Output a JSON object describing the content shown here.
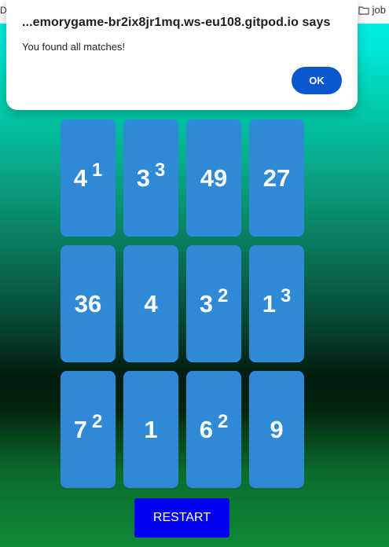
{
  "browser": {
    "left_fragment": "Dr",
    "bookmark_label": "job"
  },
  "dialog": {
    "title": "...emorygame-br2ix8jr1mq.ws-eu108.gitpod.io says",
    "message": "You found all matches!",
    "ok_label": "OK"
  },
  "cards": [
    {
      "base": "4",
      "exp": "1"
    },
    {
      "base": "3",
      "exp": "3"
    },
    {
      "base": "49",
      "exp": ""
    },
    {
      "base": "27",
      "exp": ""
    },
    {
      "base": "36",
      "exp": ""
    },
    {
      "base": "4",
      "exp": ""
    },
    {
      "base": "3",
      "exp": "2"
    },
    {
      "base": "1",
      "exp": "3"
    },
    {
      "base": "7",
      "exp": "2"
    },
    {
      "base": "1",
      "exp": ""
    },
    {
      "base": "6",
      "exp": "2"
    },
    {
      "base": "9",
      "exp": ""
    }
  ],
  "restart_label": "RESTART",
  "colors": {
    "card": "#2e89d6",
    "restart": "#0000f5",
    "ok_button": "#0b57d0"
  }
}
